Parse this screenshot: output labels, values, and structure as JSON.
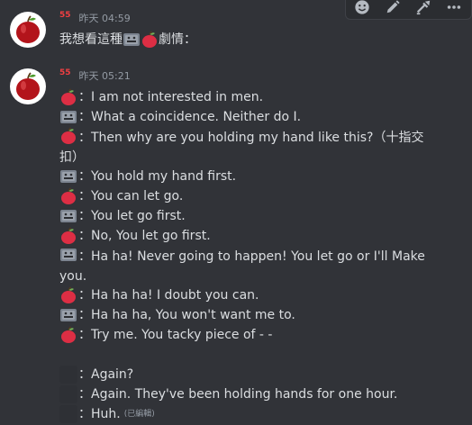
{
  "toolbar": {
    "buttons": [
      {
        "icon": "add-reaction-icon"
      },
      {
        "icon": "edit-icon"
      },
      {
        "icon": "forward-icon"
      },
      {
        "icon": "more-icon"
      }
    ]
  },
  "messages": [
    {
      "username": "55",
      "timestamp": "昨天 04:59",
      "lines": [
        {
          "text_before": "我想看這種",
          "text_after": "劇情："
        }
      ]
    },
    {
      "username": "55",
      "timestamp": "昨天 05:21",
      "lines": [
        {
          "speaker": "apple",
          "text": "：I am not interested in men."
        },
        {
          "speaker": "robot",
          "text": "：What a coincidence. Neither do I."
        },
        {
          "speaker": "apple",
          "text": "：Then why are you holding my hand like this?（十指交扣）"
        },
        {
          "speaker": "robot",
          "text": "：You hold my hand first."
        },
        {
          "speaker": "apple",
          "text": "：You can let go."
        },
        {
          "speaker": "robot",
          "text": "：You let go first."
        },
        {
          "speaker": "apple",
          "text": "：No, You let go first."
        },
        {
          "speaker": "robot",
          "text": "：Ha ha! Never going to happen! You let go or I'll Make you."
        },
        {
          "speaker": "apple",
          "text": "：Ha ha ha! I doubt you can."
        },
        {
          "speaker": "robot",
          "text": "：Ha ha ha, You won't want me to."
        },
        {
          "speaker": "apple",
          "text": "：Try me. You tacky piece of - -"
        },
        {
          "speaker": "ghost",
          "text": "：Again?"
        },
        {
          "speaker": "ghost",
          "text": "：Again. They've been holding hands for one hour."
        },
        {
          "speaker": "ghost",
          "text": "：Huh.",
          "edited": "(已編輯)"
        }
      ]
    }
  ],
  "colors": {
    "background": "#313338",
    "text": "#dbdee1",
    "username": "#f23f42",
    "timestamp": "#949ba4"
  }
}
